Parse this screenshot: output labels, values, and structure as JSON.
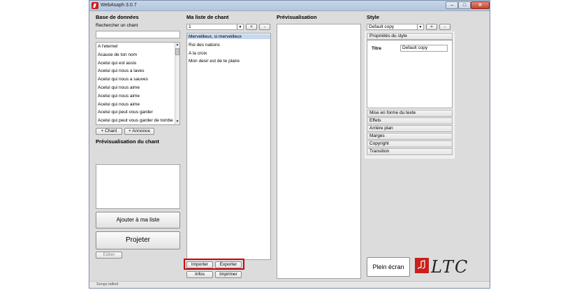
{
  "window": {
    "title": "WebAsaph 3.0.7"
  },
  "database": {
    "heading": "Base de données",
    "search_label": "Rechercher un chant",
    "search_value": "",
    "songs": [
      "A l'eternel",
      "Acause de ton nom",
      "Acelui qui est assis",
      "Acelui qui nous a laves",
      "Acelui qui nous a sauves",
      "Acelui qui nous aime",
      "Acelui qui nous aime",
      "Acelui qui nous aime",
      "Acelui qui peut vous garder",
      "Acelui qui peut vous garder de tombe"
    ],
    "add_song_label": "+ Chant",
    "add_announce_label": "+ Annonce",
    "preview_heading": "Prévisualisation du chant",
    "add_to_list_label": "Ajouter à ma liste",
    "project_label": "Projeter",
    "edit_label": "Editer"
  },
  "mylist": {
    "heading": "Ma liste de chant",
    "select_value": "1",
    "plus_label": "+",
    "minus_label": "-",
    "items": [
      "Merveilleux, si merveilleux",
      "Roi des nations",
      "A la croix",
      "Mon desir est de te plaire"
    ],
    "import_label": "Importer",
    "export_label": "Exporter",
    "info_label": "Infos",
    "print_label": "Imprimer"
  },
  "preview": {
    "heading": "Prévisualisation"
  },
  "style": {
    "heading": "Style",
    "select_value": "Default copy",
    "plus_label": "+",
    "minus_label": "-",
    "properties_label": "Propriétés du style",
    "title_label": "Titre",
    "title_value": "Default copy",
    "sections": [
      "Mise en forme du texte",
      "Effets",
      "Arrière plan",
      "Marges",
      "Copyright",
      "Transition"
    ],
    "fullscreen_label": "Plein écran",
    "logo_text": "LTC"
  },
  "status": {
    "text": "Songs tallied"
  },
  "colors": {
    "highlight": "#d40000",
    "selection": "#c5d9f1",
    "logo_red": "#c8201c"
  }
}
